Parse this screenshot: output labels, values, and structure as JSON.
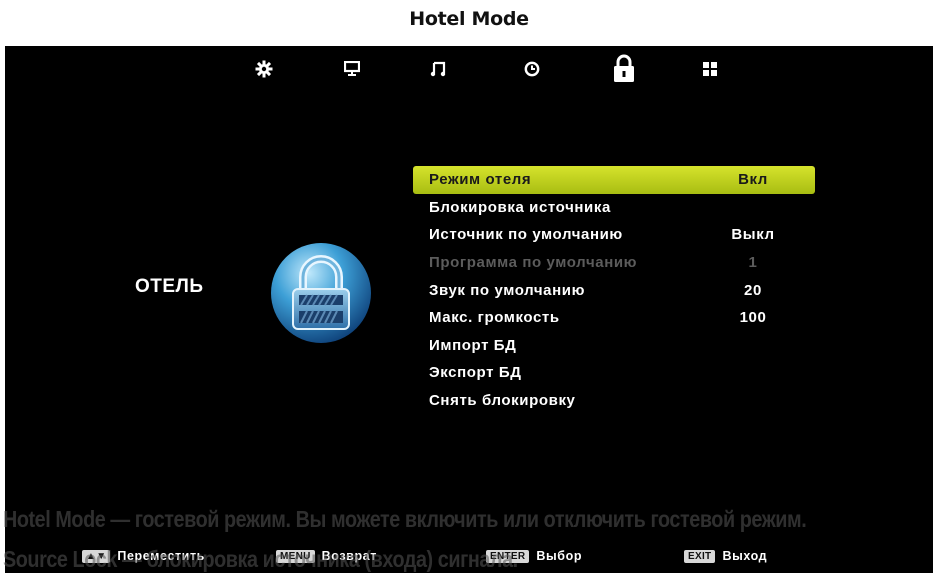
{
  "page_title": "Hotel Mode",
  "top_menu": {
    "icons": [
      "gear-icon",
      "monitor-icon",
      "music-icon",
      "clock-icon",
      "lock-icon",
      "apps-icon"
    ],
    "active": "lock-icon"
  },
  "section_label": "ОТЕЛЬ",
  "menu": {
    "items": [
      {
        "label": "Режим отеля",
        "value": "Вкл",
        "state": "selected"
      },
      {
        "label": "Блокировка источника",
        "value": "",
        "state": "normal"
      },
      {
        "label": "Источник по умолчанию",
        "value": "Выкл",
        "state": "normal"
      },
      {
        "label": "Программа по умолчанию",
        "value": "1",
        "state": "disabled"
      },
      {
        "label": "Звук по умолчанию",
        "value": "20",
        "state": "normal"
      },
      {
        "label": "Макс. громкость",
        "value": "100",
        "state": "normal"
      },
      {
        "label": "Импорт БД",
        "value": "",
        "state": "normal"
      },
      {
        "label": "Экспорт БД",
        "value": "",
        "state": "normal"
      },
      {
        "label": "Снять блокировку",
        "value": "",
        "state": "normal"
      }
    ]
  },
  "caption": {
    "line1": "Hotel Mode — гостевой режим. Вы можете включить или отключить гостевой режим.",
    "line2": "Source Lock — блокировка источника (входа) сигнала."
  },
  "hints": {
    "move": {
      "key": "▲▼",
      "label": "Переместить"
    },
    "back": {
      "key": "MENU",
      "label": "Возврат"
    },
    "select": {
      "key": "ENTER",
      "label": "Выбор"
    },
    "exit": {
      "key": "EXIT",
      "label": "Выход"
    }
  },
  "colors": {
    "screen_bg": "#000000",
    "highlight": "#c4d422",
    "text": "#ffffff",
    "disabled_text": "#5c5c5c"
  }
}
